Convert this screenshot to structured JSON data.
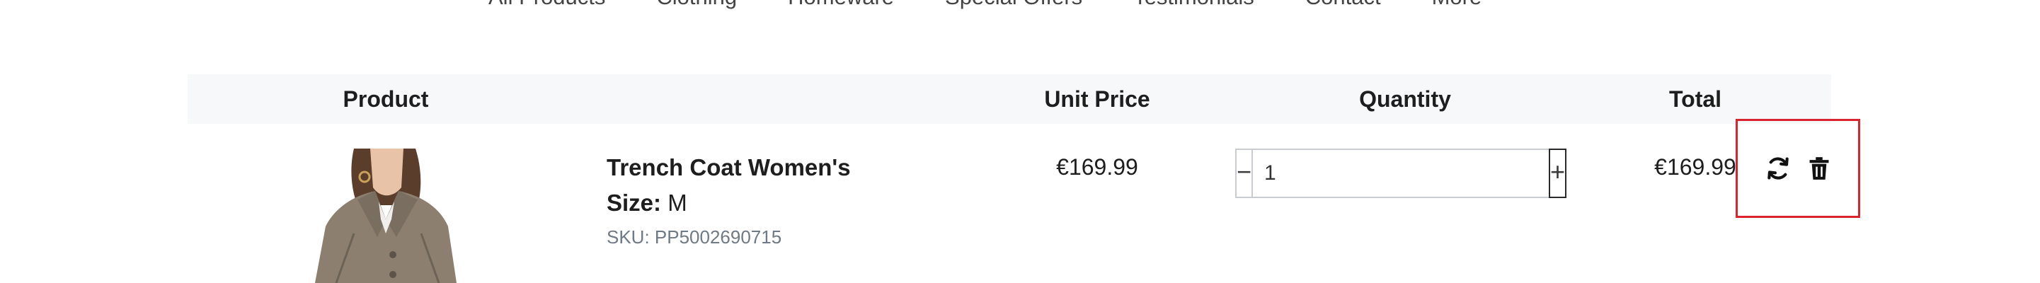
{
  "nav": {
    "items": [
      "All Products",
      "Clothing",
      "Homeware",
      "Special Offers",
      "Testimonials",
      "Contact",
      "More"
    ]
  },
  "table": {
    "headers": {
      "product": "Product",
      "unit_price": "Unit Price",
      "quantity": "Quantity",
      "total": "Total"
    }
  },
  "item": {
    "name": "Trench Coat Women's",
    "size_label": "Size:",
    "size_value": "M",
    "sku": "SKU: PP5002690715",
    "unit_price": "€169.99",
    "quantity": "1",
    "decrement_symbol": "−",
    "increment_symbol": "+",
    "total": "€169.99"
  },
  "actions": {
    "update_icon": "refresh-icon",
    "delete_icon": "trash-icon",
    "highlight_color": "#d9232e"
  }
}
